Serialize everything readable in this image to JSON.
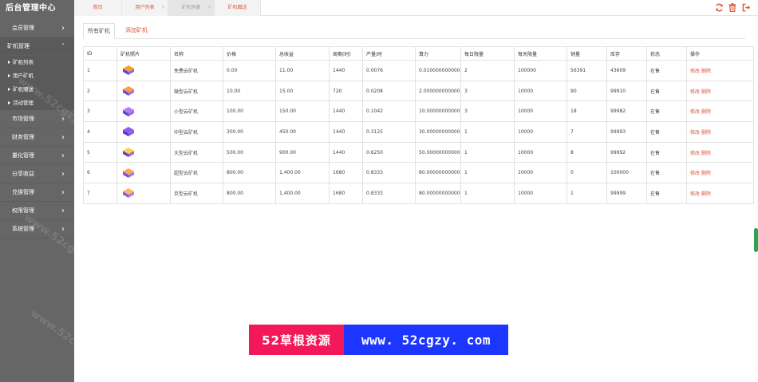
{
  "sidebar": {
    "brand": "后台管理中心",
    "watermark_text": "www.52cgzy.com",
    "menu_before": [
      {
        "label": "会员管理"
      }
    ],
    "open_menu": {
      "label": "矿机管理",
      "items": [
        {
          "label": "矿机列表"
        },
        {
          "label": "用户矿机"
        },
        {
          "label": "矿机赠送"
        },
        {
          "label": "活动管理"
        }
      ]
    },
    "menu_after": [
      {
        "label": "市场管理"
      },
      {
        "label": "财务管理"
      },
      {
        "label": "量化管理"
      },
      {
        "label": "分享收益"
      },
      {
        "label": "兑换管理"
      },
      {
        "label": "权限管理"
      },
      {
        "label": "系统管理"
      }
    ]
  },
  "topbar": {
    "tabs": [
      {
        "label": "首页"
      },
      {
        "label": "用户列表"
      },
      {
        "label": "矿机列表"
      },
      {
        "label": "矿机赠送"
      }
    ],
    "close_glyph": "×",
    "icons": {
      "refresh_color": "#e0543a",
      "trash_color": "#e0543a",
      "logout_color": "#e0543a"
    }
  },
  "subtabs": {
    "all_label": "所有矿机",
    "add_label": "添加矿机"
  },
  "table": {
    "headers": [
      "ID",
      "矿机照片",
      "名称",
      "价格",
      "总收益",
      "周期(时)",
      "产量/时",
      "算力",
      "每日限量",
      "每天限量",
      "销量",
      "库存",
      "状态",
      "操作"
    ],
    "edit_label": "修改",
    "delete_label": "删除",
    "rows": [
      {
        "id": "1",
        "name": "免费云矿机",
        "price": "0.00",
        "total": "11.00",
        "cycle": "1440",
        "output": "0.0076",
        "power": "0.010000000000",
        "daily": "2",
        "day_limit": "100000",
        "sold": "56391",
        "stock": "43609",
        "status": "在售",
        "img_color": "#6a3fd0",
        "img_accent": "#f0a030"
      },
      {
        "id": "2",
        "name": "微型云矿机",
        "price": "10.00",
        "total": "15.00",
        "cycle": "720",
        "output": "0.0208",
        "power": "2.000000000000",
        "daily": "3",
        "day_limit": "10000",
        "sold": "90",
        "stock": "99910",
        "status": "在售",
        "img_color": "#7a45dc",
        "img_accent": "#ff9d3a"
      },
      {
        "id": "3",
        "name": "小型云矿机",
        "price": "100.00",
        "total": "150.00",
        "cycle": "1440",
        "output": "0.1042",
        "power": "10.000000000000",
        "daily": "3",
        "day_limit": "10000",
        "sold": "18",
        "stock": "99982",
        "status": "在售",
        "img_color": "#6d3fd8",
        "img_accent": "#b47bff"
      },
      {
        "id": "4",
        "name": "中型云矿机",
        "price": "300.00",
        "total": "450.00",
        "cycle": "1440",
        "output": "0.3125",
        "power": "30.000000000000",
        "daily": "1",
        "day_limit": "10000",
        "sold": "7",
        "stock": "99993",
        "status": "在售",
        "img_color": "#5c34c8",
        "img_accent": "#8d5cf0"
      },
      {
        "id": "5",
        "name": "大型云矿机",
        "price": "500.00",
        "total": "900.00",
        "cycle": "1440",
        "output": "0.6250",
        "power": "50.000000000000",
        "daily": "1",
        "day_limit": "10000",
        "sold": "8",
        "stock": "99992",
        "status": "在售",
        "img_color": "#6a3fd0",
        "img_accent": "#ffd24a"
      },
      {
        "id": "6",
        "name": "超型云矿机",
        "price": "800.00",
        "total": "1,400.00",
        "cycle": "1680",
        "output": "0.8333",
        "power": "80.000000000000",
        "daily": "1",
        "day_limit": "10000",
        "sold": "0",
        "stock": "100000",
        "status": "在售",
        "img_color": "#7a4ee0",
        "img_accent": "#ffa94d"
      },
      {
        "id": "7",
        "name": "巨型云矿机",
        "price": "800.00",
        "total": "1,400.00",
        "cycle": "1680",
        "output": "0.8333",
        "power": "80.000000000000",
        "daily": "1",
        "day_limit": "10000",
        "sold": "1",
        "stock": "99999",
        "status": "在售",
        "img_color": "#8a5ae8",
        "img_accent": "#ffb85c"
      }
    ]
  },
  "banner": {
    "left_text": "52草根资源",
    "right_text": "www. 52cgzy. com"
  }
}
